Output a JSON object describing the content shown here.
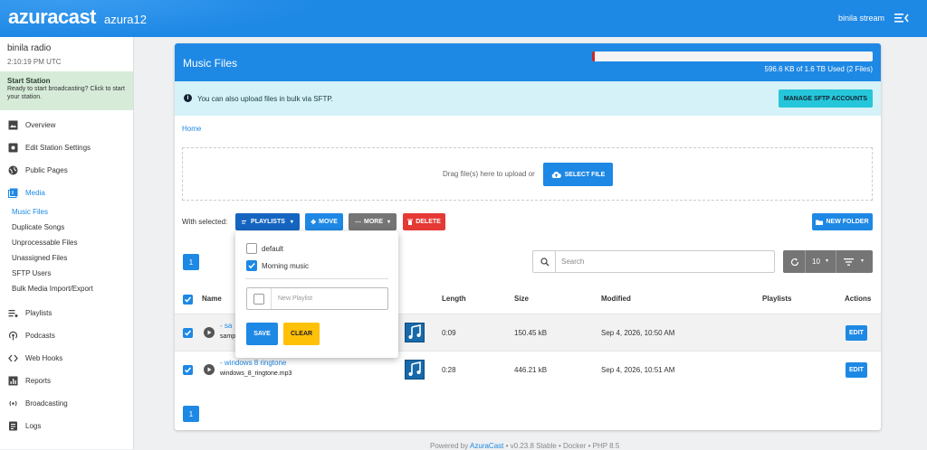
{
  "header": {
    "brand": "azuracast",
    "instance": "azura12",
    "user": "binila stream"
  },
  "sidebar": {
    "station_name": "binila radio",
    "station_time": "2:10:19 PM UTC",
    "start_title": "Start Station",
    "start_desc": "Ready to start broadcasting? Click to start your station.",
    "items": [
      {
        "label": "Overview",
        "icon": "image-icon"
      },
      {
        "label": "Edit Station Settings",
        "icon": "settings-icon"
      },
      {
        "label": "Public Pages",
        "icon": "globe-icon"
      },
      {
        "label": "Media",
        "icon": "media-icon"
      }
    ],
    "media_sub": [
      "Music Files",
      "Duplicate Songs",
      "Unprocessable Files",
      "Unassigned Files",
      "SFTP Users",
      "Bulk Media Import/Export"
    ],
    "items2": [
      {
        "label": "Playlists",
        "icon": "playlist-icon"
      },
      {
        "label": "Podcasts",
        "icon": "podcast-icon"
      },
      {
        "label": "Web Hooks",
        "icon": "code-icon"
      },
      {
        "label": "Reports",
        "icon": "report-icon"
      },
      {
        "label": "Broadcasting",
        "icon": "broadcast-icon"
      },
      {
        "label": "Logs",
        "icon": "logs-icon"
      }
    ]
  },
  "card": {
    "title": "Music Files",
    "usage": "596.6 KB of 1.6 TB Used (2 Files)",
    "usage_fraction": 0.01,
    "info": "You can also upload files in bulk via SFTP.",
    "sftp_button": "MANAGE SFTP ACCOUNTS",
    "breadcrumb": "Home",
    "drop_text": "Drag file(s) here to upload or",
    "select_file": "SELECT FILE",
    "with_selected": "With selected:",
    "playlists_btn": "PLAYLISTS",
    "move_btn": "MOVE",
    "more_btn": "MORE",
    "delete_btn": "DELETE",
    "new_folder_btn": "NEW FOLDER",
    "page": "1",
    "search_placeholder": "Search",
    "per_page": "10"
  },
  "table": {
    "headers": {
      "name": "Name",
      "length": "Length",
      "size": "Size",
      "modified": "Modified",
      "playlists": "Playlists",
      "actions": "Actions"
    },
    "rows": [
      {
        "title": "- sa",
        "file": "samp",
        "length": "0:09",
        "size": "150.45 kB",
        "modified": "Sep 4, 2026, 10:50 AM",
        "action": "EDIT"
      },
      {
        "title": "- windows 8 ringtone",
        "file": "windows_8_ringtone.mp3",
        "length": "0:28",
        "size": "446.21 kB",
        "modified": "Sep 4, 2026, 10:51 AM",
        "action": "EDIT"
      }
    ]
  },
  "dropdown": {
    "items": [
      {
        "label": "default",
        "checked": false
      },
      {
        "label": "Morning music",
        "checked": true
      }
    ],
    "new_placeholder": "New Playlist",
    "save": "SAVE",
    "clear": "CLEAR"
  },
  "footer": {
    "prefix": "Powered by",
    "link": "AzuraCast",
    "suffix": "• v0.23.8 Stable • Docker • PHP 8.5"
  },
  "colors": {
    "primary": "#1e88e5",
    "info_bg": "#d4f2f8",
    "danger": "#e53935",
    "warning": "#ffc107",
    "start_bg": "#d6ecd9"
  }
}
